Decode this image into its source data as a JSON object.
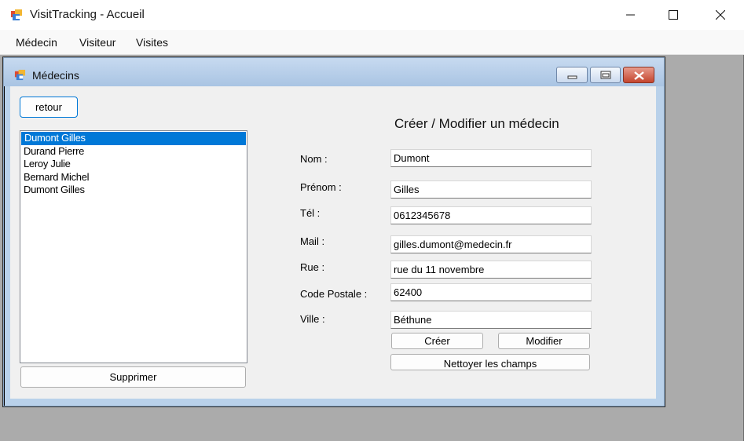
{
  "app": {
    "title": "VisitTracking - Accueil",
    "icon": "app-window-icon"
  },
  "menu": {
    "items": [
      "Médecin",
      "Visiteur",
      "Visites"
    ]
  },
  "child_window": {
    "title": "Médecins",
    "icon": "child-window-icon"
  },
  "buttons": {
    "back": "retour",
    "delete": "Supprimer",
    "create": "Créer",
    "modify": "Modifier",
    "clear": "Nettoyer les champs"
  },
  "doctor_list": [
    "Dumont Gilles",
    "Durand Pierre",
    "Leroy Julie",
    "Bernard Michel",
    "Dumont Gilles"
  ],
  "selected_index": 0,
  "form": {
    "title": "Créer / Modifier un médecin",
    "fields": [
      {
        "label": "Nom :",
        "value": "Dumont"
      },
      {
        "label": "Prénom :",
        "value": "Gilles"
      },
      {
        "label": "Tél :",
        "value": "0612345678"
      },
      {
        "label": "Mail :",
        "value": "gilles.dumont@medecin.fr"
      },
      {
        "label": "Rue :",
        "value": "rue du 11 novembre"
      },
      {
        "label": "Code Postale :",
        "value": "62400"
      },
      {
        "label": "Ville :",
        "value": "Béthune"
      }
    ]
  },
  "colors": {
    "selection": "#0078d7",
    "mdi_background": "#ababab",
    "child_frame": "#b9d1ea"
  }
}
